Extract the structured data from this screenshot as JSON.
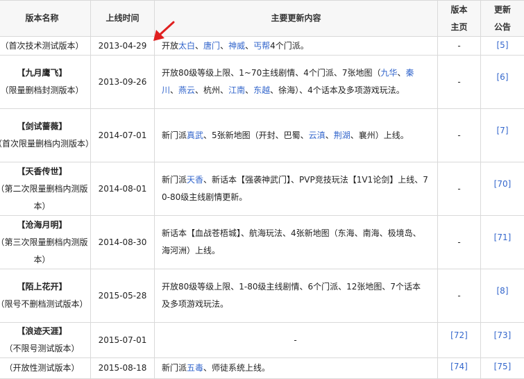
{
  "headers": {
    "name": "版本名称",
    "date": "上线时间",
    "content": "主要更新内容",
    "home_line1": "版本",
    "home_line2": "主页",
    "notice_line1": "更新",
    "notice_line2": "公告"
  },
  "colors": {
    "link": "#3366cc",
    "arrow": "#e02020",
    "border": "#d9d9d9",
    "header_bg": "#f7f7f7"
  },
  "rows": [
    {
      "title": "",
      "sub": "（首次技术测试版本）",
      "date": "2013-04-29",
      "content": [
        {
          "t": "开放"
        },
        {
          "t": "太白",
          "link": true
        },
        {
          "t": "、"
        },
        {
          "t": "唐门",
          "link": true
        },
        {
          "t": "、"
        },
        {
          "t": "神威",
          "link": true
        },
        {
          "t": "、"
        },
        {
          "t": "丐帮",
          "link": true
        },
        {
          "t": "4个门派。"
        }
      ],
      "home": "-",
      "notice": "[5]"
    },
    {
      "title": "【九月鹰飞】",
      "sub": "（限量删档封测版本）",
      "date": "2013-09-26",
      "content": [
        {
          "t": "开放80级等级上限、1~70主线剧情、4个门派、7张地图（"
        },
        {
          "t": "九华",
          "link": true
        },
        {
          "t": "、"
        },
        {
          "t": "秦川",
          "link": true
        },
        {
          "t": "、"
        },
        {
          "t": "燕云",
          "link": true
        },
        {
          "t": "、杭州、"
        },
        {
          "t": "江南",
          "link": true
        },
        {
          "t": "、"
        },
        {
          "t": "东越",
          "link": true
        },
        {
          "t": "、徐海）、4个话本及多项游戏玩法。"
        }
      ],
      "home": "-",
      "notice": "[6]"
    },
    {
      "title": "【剑试蔷薇】",
      "sub": "（首次限量删档内测版本）",
      "date": "2014-07-01",
      "content": [
        {
          "t": "新门派"
        },
        {
          "t": "真武",
          "link": true
        },
        {
          "t": "、5张新地图（开封、巴蜀、"
        },
        {
          "t": "云滇",
          "link": true
        },
        {
          "t": "、"
        },
        {
          "t": "荆湖",
          "link": true
        },
        {
          "t": "、襄州）上线。"
        }
      ],
      "home": "-",
      "notice": "[7]"
    },
    {
      "title": "【天香传世】",
      "sub": "（第二次限量删档内测版本）",
      "date": "2014-08-01",
      "content": [
        {
          "t": "新门派"
        },
        {
          "t": "天香",
          "link": true
        },
        {
          "t": "、新话本【强袭神武门】、PVP竞技玩法【1V1论剑】上线、70-80级主线剧情更新。"
        }
      ],
      "home": "-",
      "notice": "[70]"
    },
    {
      "title": "【沧海月明】",
      "sub": "（第三次限量删档内测版本）",
      "date": "2014-08-30",
      "content": [
        {
          "t": "新话本【血战苍梧城】、航海玩法、4张新地图（东海、南海、极境岛、海河洲）上线。"
        }
      ],
      "home": "-",
      "notice": "[71]"
    },
    {
      "title": "【陌上花开】",
      "sub": "（限号不删档测试版本）",
      "date": "2015-05-28",
      "content": [
        {
          "t": "开放80级等级上限、1-80级主线剧情、6个门派、12张地图、7个话本及多项游戏玩法。"
        }
      ],
      "home": "-",
      "notice": "[8]"
    },
    {
      "title": "【浪迹天涯】",
      "sub": "（不限号测试版本）",
      "date": "2015-07-01",
      "content": [
        {
          "t": "-"
        }
      ],
      "home": "[72]",
      "notice": "[73]"
    },
    {
      "title": "",
      "sub": "（开放性测试版本）",
      "date": "2015-08-18",
      "content": [
        {
          "t": "新门派"
        },
        {
          "t": "五毒",
          "link": true
        },
        {
          "t": "、师徒系统上线。"
        }
      ],
      "home": "[74]",
      "notice": "[75]"
    }
  ]
}
